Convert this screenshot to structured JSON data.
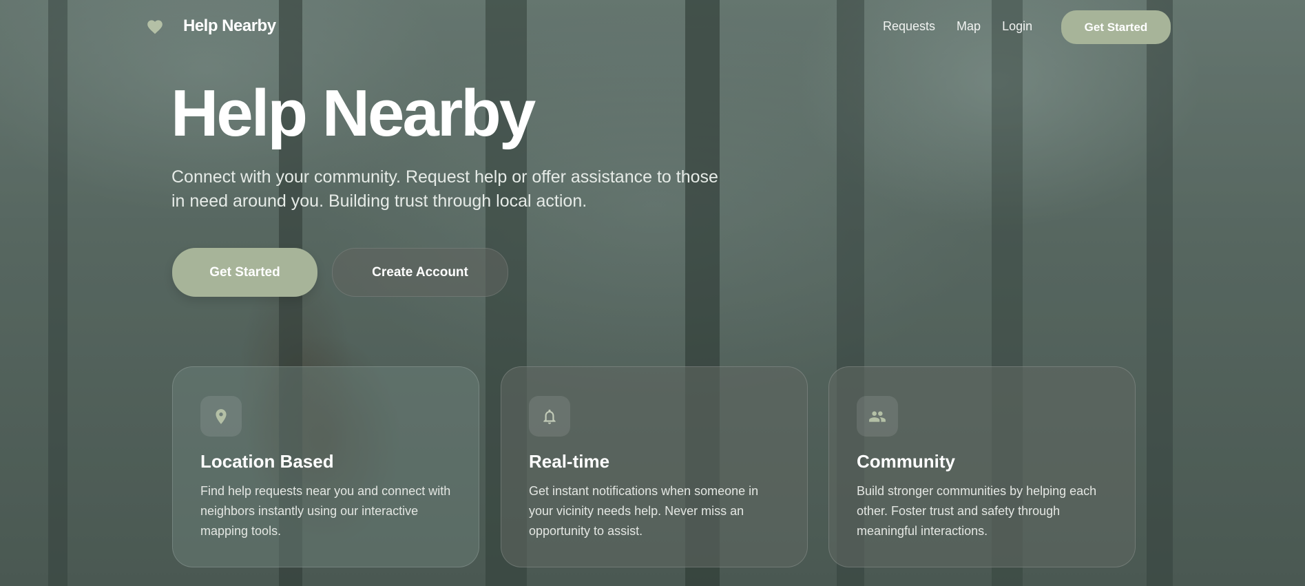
{
  "nav": {
    "brand_name": "Help Nearby",
    "brand_icon": "heart-icon",
    "links": [
      "Requests",
      "Map",
      "Login"
    ],
    "cta_label": "Get Started"
  },
  "hero": {
    "title": "Help Nearby",
    "subtitle": "Connect with your community. Request help or offer assistance to those in need around you. Building trust through local action.",
    "primary_button": "Get Started",
    "secondary_button": "Create Account"
  },
  "features": [
    {
      "icon": "location-pin-icon",
      "title": "Location Based",
      "text": "Find help requests near you and connect with neighbors instantly using our interactive mapping tools."
    },
    {
      "icon": "bell-icon",
      "title": "Real-time",
      "text": "Get instant notifications when someone in your vicinity needs help. Never miss an opportunity to assist."
    },
    {
      "icon": "people-icon",
      "title": "Community",
      "text": "Build stronger communities by helping each other. Foster trust and safety through meaningful interactions."
    }
  ],
  "colors": {
    "accent": "#a7b499",
    "text": "#ffffff"
  }
}
